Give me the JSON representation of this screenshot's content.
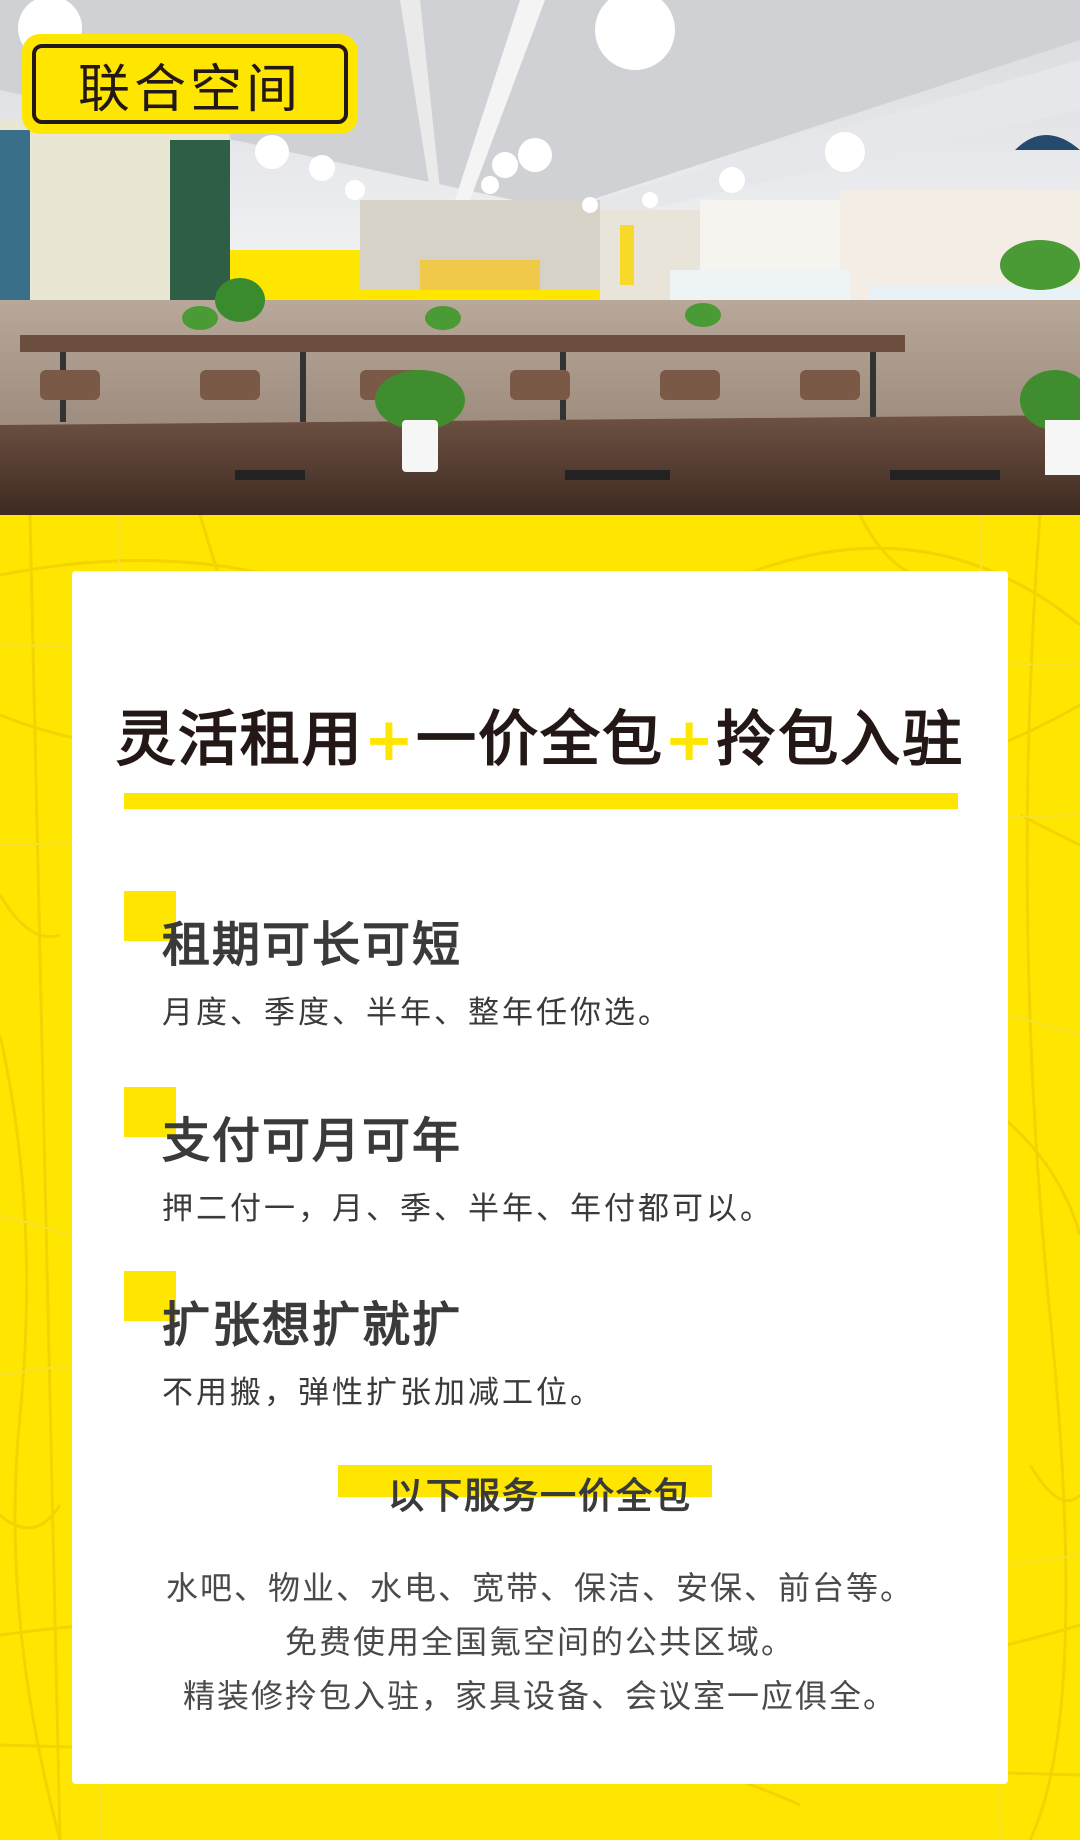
{
  "hero": {
    "tag_label": "联合空间"
  },
  "card": {
    "headline": {
      "part1": "灵活租用",
      "plus": "+",
      "part2": "一价全包",
      "part3": "拎包入驻"
    },
    "features": [
      {
        "title": "租期可长可短",
        "desc": "月度、季度、半年、整年任你选。"
      },
      {
        "title": "支付可月可年",
        "desc": "押二付一，月、季、半年、年付都可以。"
      },
      {
        "title": "扩张想扩就扩",
        "desc": "不用搬，弹性扩张加减工位。"
      }
    ],
    "services_heading": "以下服务一价全包",
    "services_lines": [
      "水吧、物业、水电、宽带、保洁、安保、前台等。",
      "免费使用全国氪空间的公共区域。",
      "精装修拎包入驻，家具设备、会议室一应俱全。"
    ]
  },
  "colors": {
    "accent_yellow": "#ffe600",
    "text_dark": "#231815",
    "text_body": "#3a3a3a"
  }
}
